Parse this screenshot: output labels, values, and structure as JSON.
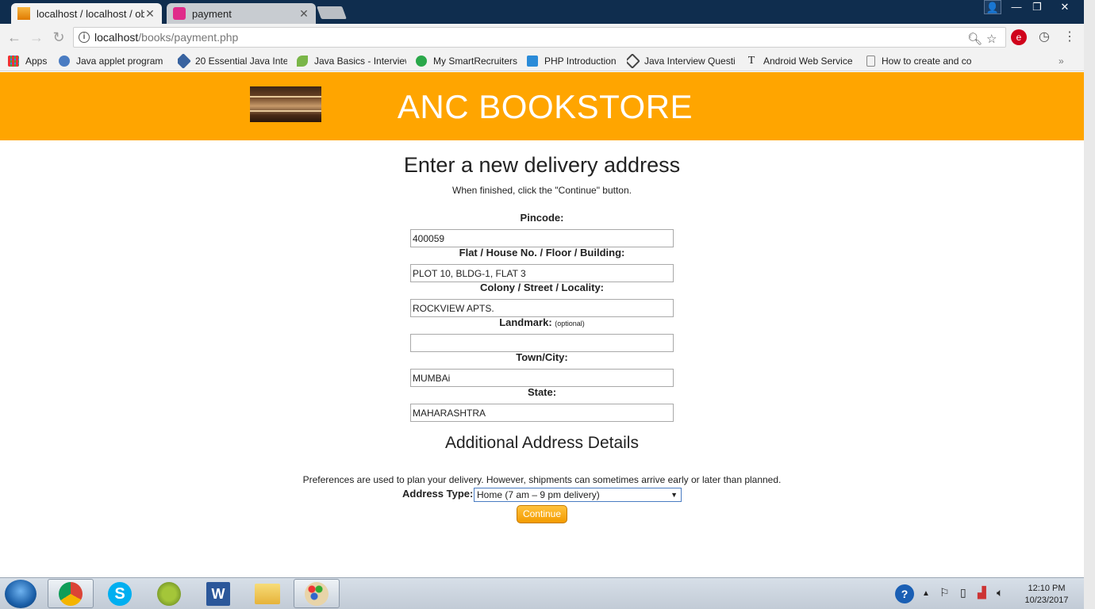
{
  "browser": {
    "tabs": [
      {
        "title": "localhost / localhost / ob",
        "close": "✕"
      },
      {
        "title": "payment",
        "close": "✕"
      }
    ],
    "window_buttons": [
      "👤",
      "—",
      "❐",
      "✕"
    ],
    "url_host": "localhost",
    "url_path": "/books/payment.php",
    "bookmarks": [
      "Apps",
      "Java applet program",
      "20 Essential Java Inte",
      "Java Basics - Interview",
      "My SmartRecruiters",
      "PHP Introduction",
      "Java Interview Questi",
      "Android Web Service",
      "How to create and co"
    ],
    "more_bookmarks": "»"
  },
  "page": {
    "site_title": "ANC BOOKSTORE",
    "heading": "Enter a new delivery address",
    "subheading": "When finished, click the \"Continue\" button.",
    "fields": {
      "pincode": {
        "label": "Pincode:",
        "value": "400059"
      },
      "flat": {
        "label": "Flat / House No. / Floor / Building:",
        "value": "PLOT 10, BLDG-1, FLAT 3"
      },
      "colony": {
        "label": "Colony / Street / Locality:",
        "value": "ROCKVIEW APTS."
      },
      "landmark": {
        "label": "Landmark:",
        "optional": "(optional)",
        "value": ""
      },
      "city": {
        "label": "Town/City:",
        "value": "MUMBAi"
      },
      "state": {
        "label": "State:",
        "value": "MAHARASHTRA"
      }
    },
    "additional_heading": "Additional Address Details",
    "preferences_text": "Preferences are used to plan your delivery. However, shipments can sometimes arrive early or later than planned.",
    "address_type_label": "Address Type:",
    "address_type_value": "Home (7 am – 9 pm delivery)",
    "continue_label": "Continue"
  },
  "taskbar": {
    "clock_time": "12:10 PM",
    "clock_date": "10/23/2017"
  },
  "colors": {
    "header": "#ffa500",
    "titlebar": "#0f2d4e",
    "button": "#f39b00"
  }
}
